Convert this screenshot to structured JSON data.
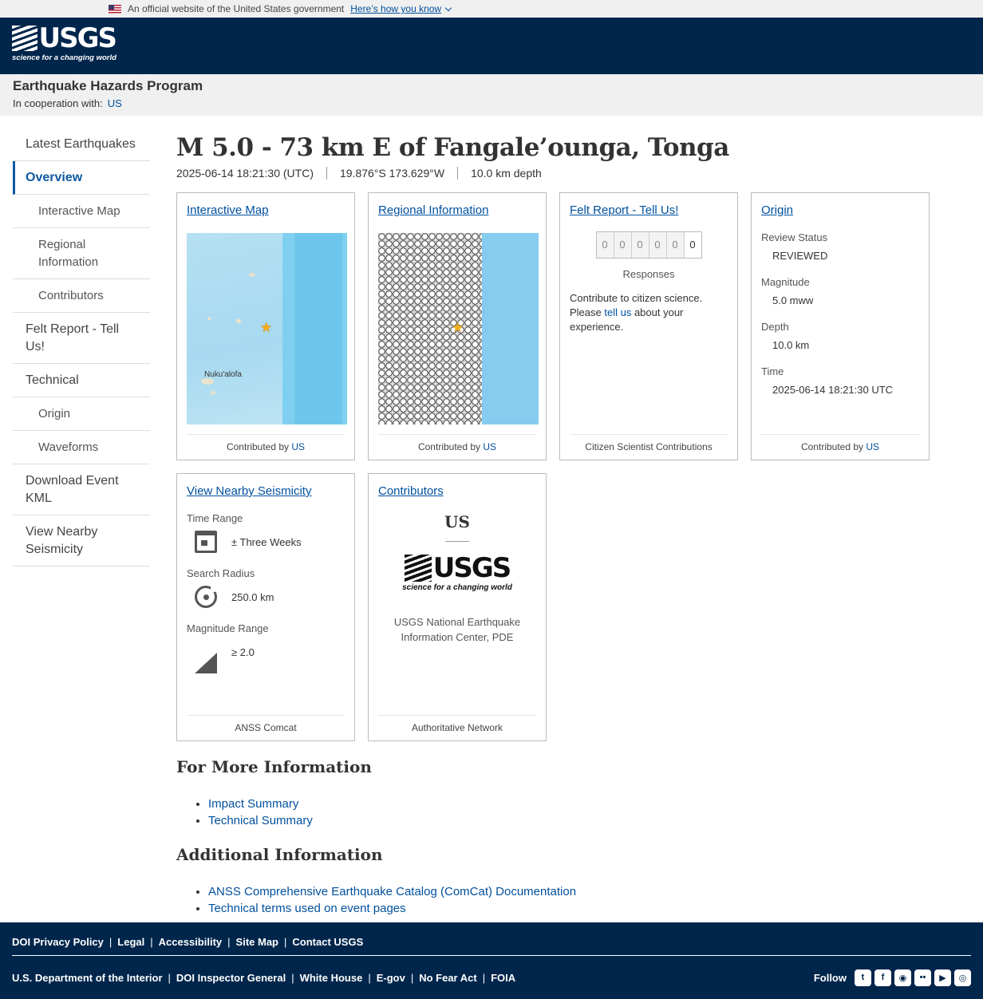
{
  "gov_banner": {
    "text": "An official website of the United States government",
    "link": "Here’s how you know"
  },
  "header": {
    "logo_text": "USGS",
    "tagline": "science for a changing world"
  },
  "program": {
    "title": "Earthquake Hazards Program",
    "coop_label": "In cooperation with:",
    "coop_link": "US"
  },
  "sidebar": {
    "items": [
      {
        "label": "Latest Earthquakes",
        "level": 0
      },
      {
        "label": "Overview",
        "level": 0,
        "active": true
      },
      {
        "label": "Interactive Map",
        "level": 1
      },
      {
        "label": "Regional Information",
        "level": 1
      },
      {
        "label": "Contributors",
        "level": 1
      },
      {
        "label": "Felt Report - Tell Us!",
        "level": 0
      },
      {
        "label": "Technical",
        "level": 0
      },
      {
        "label": "Origin",
        "level": 1
      },
      {
        "label": "Waveforms",
        "level": 1
      },
      {
        "label": "Download Event KML",
        "level": 0
      },
      {
        "label": "View Nearby Seismicity",
        "level": 0
      }
    ]
  },
  "event": {
    "title": "M 5.0 - 73 km E of Fangale’ounga, Tonga",
    "time": "2025-06-14 18:21:30 (UTC)",
    "location": "19.876°S 173.629°W",
    "depth": "10.0 km depth"
  },
  "cards": {
    "interactive_map": {
      "title": "Interactive Map",
      "map_label": "Nuku'alofa",
      "contributed_by": "Contributed by",
      "contributor": "US"
    },
    "regional": {
      "title": "Regional Information",
      "contributed_by": "Contributed by",
      "contributor": "US"
    },
    "felt": {
      "title": "Felt Report - Tell Us!",
      "digits": [
        "0",
        "0",
        "0",
        "0",
        "0",
        "0"
      ],
      "responses_label": "Responses",
      "text_before": "Contribute to citizen science. Please ",
      "link": "tell us",
      "text_after": " about your experience.",
      "footer": "Citizen Scientist Contributions"
    },
    "origin": {
      "title": "Origin",
      "review_label": "Review Status",
      "review_value": "REVIEWED",
      "mag_label": "Magnitude",
      "mag_value": "5.0 mww",
      "depth_label": "Depth",
      "depth_value": "10.0 km",
      "time_label": "Time",
      "time_value": "2025-06-14 18:21:30 UTC",
      "contributed_by": "Contributed by",
      "contributor": "US"
    },
    "seismicity": {
      "title": "View Nearby Seismicity",
      "time_label": "Time Range",
      "time_value": "± Three Weeks",
      "radius_label": "Search Radius",
      "radius_value": "250.0 km",
      "mag_label": "Magnitude Range",
      "mag_value": "≥ 2.0",
      "footer": "ANSS Comcat"
    },
    "contributors": {
      "title": "Contributors",
      "code": "US",
      "logo_text": "USGS",
      "tagline": "science for a changing world",
      "name": "USGS National Earthquake Information Center, PDE",
      "footer": "Authoritative Network"
    }
  },
  "more_info": {
    "heading": "For More Information",
    "links": [
      "Impact Summary",
      "Technical Summary"
    ]
  },
  "additional": {
    "heading": "Additional Information",
    "links": [
      "ANSS Comprehensive Earthquake Catalog (ComCat) Documentation",
      "Technical terms used on event pages"
    ]
  },
  "footer": {
    "top_links": [
      "DOI Privacy Policy",
      "Legal",
      "Accessibility",
      "Site Map",
      "Contact USGS"
    ],
    "bottom_links": [
      "U.S. Department of the Interior",
      "DOI Inspector General",
      "White House",
      "E-gov",
      "No Fear Act",
      "FOIA"
    ],
    "follow": "Follow",
    "social_icons": [
      "twitter-icon",
      "facebook-icon",
      "github-icon",
      "flickr-icon",
      "youtube-icon",
      "instagram-icon"
    ]
  }
}
